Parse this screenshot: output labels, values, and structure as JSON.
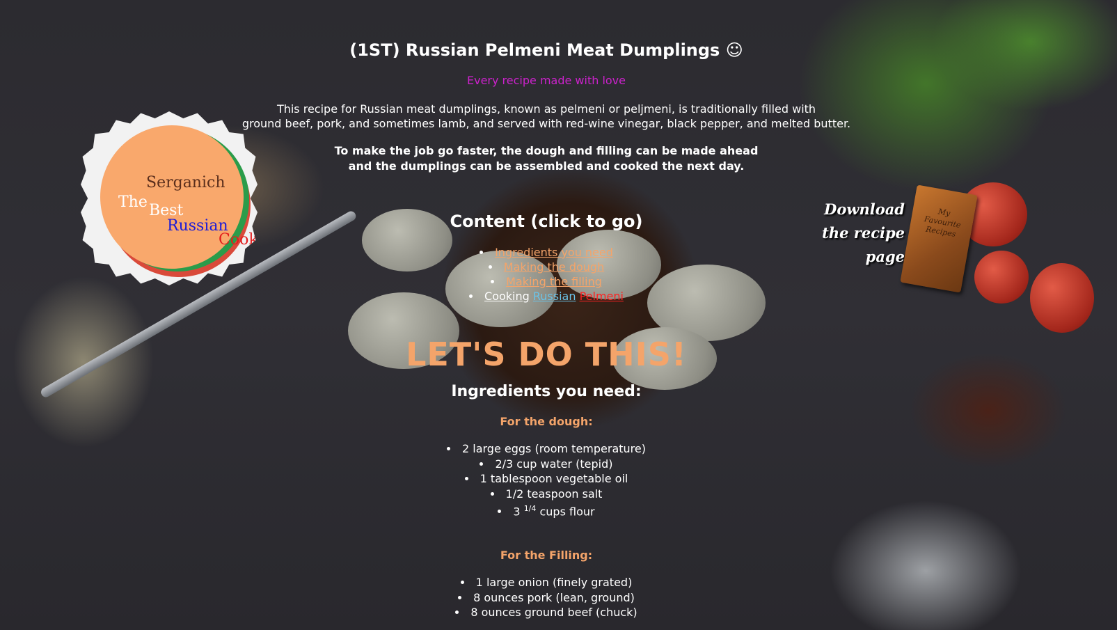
{
  "logo": {
    "line1": "Serganich",
    "line2": "The",
    "line3": "Best",
    "line4": "Russian",
    "line5": "Cook"
  },
  "header": {
    "title": "(1ST) Russian Pelmeni Meat Dumplings ☺",
    "tagline": "Every recipe made with love"
  },
  "intro": {
    "line1": "This recipe for Russian meat dumplings, known as pelmeni or peljmeni, is traditionally filled with",
    "line2": "ground beef, pork, and sometimes lamb, and served with red-wine vinegar, black pepper, and melted butter."
  },
  "tip": {
    "line1": "To make the job go faster, the dough and filling can be made ahead",
    "line2": "and the dumplings can be assembled and cooked the next day."
  },
  "toc": {
    "heading": "Content (click to go)",
    "items": [
      "Ingredients you need",
      "Making the dough",
      "Making the filling"
    ],
    "cooking": {
      "word1": "Cooking",
      "word2": "Russian",
      "word3": "Pelmeni"
    }
  },
  "download": {
    "line1": "Download",
    "line2": "the recipe page",
    "book_line1": "My",
    "book_line2": "Favourite",
    "book_line3": "Recipes"
  },
  "hero": "LET'S DO THIS!",
  "ingredients": {
    "heading": "Ingredients you need:",
    "dough_heading": "For the dough:",
    "dough": [
      "2 large eggs (room temperature)",
      "2/3 cup water (tepid)",
      "1 tablespoon vegetable oil",
      "1/2 teaspoon salt"
    ],
    "flour": {
      "prefix": "3",
      "fraction": "1/4",
      "suffix": "cups flour"
    },
    "filling_heading": "For the Filling:",
    "filling": [
      "1 large onion (finely grated)",
      "8 ounces pork (lean, ground)",
      "8 ounces ground beef (chuck)"
    ]
  }
}
